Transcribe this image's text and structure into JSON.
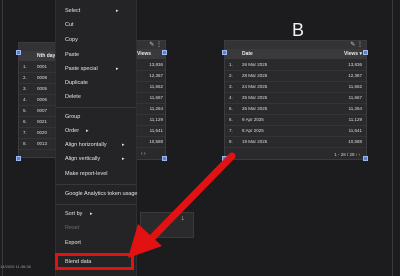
{
  "footer": {
    "timestamp": "14/2025 11:36:36"
  },
  "letter_b": "B",
  "table_left": {
    "header": "Nth day",
    "rows": [
      {
        "num": "1.",
        "val": "0001"
      },
      {
        "num": "2.",
        "val": "0008"
      },
      {
        "num": "3.",
        "val": "0005"
      },
      {
        "num": "4.",
        "val": "0006"
      },
      {
        "num": "5.",
        "val": "0007"
      },
      {
        "num": "6.",
        "val": "0021"
      },
      {
        "num": "7.",
        "val": "0020"
      },
      {
        "num": "8.",
        "val": "0013"
      }
    ]
  },
  "table_mid": {
    "header": "Views",
    "values": [
      "13,836",
      "12,367",
      "11,662",
      "11,667",
      "11,264",
      "11,129",
      "11,641",
      "10,588"
    ]
  },
  "table_right": {
    "col_date": "Date",
    "col_views": "Views",
    "rows": [
      {
        "num": "1.",
        "date": "26 Mar 2025",
        "views": "13,836"
      },
      {
        "num": "2.",
        "date": "28 Mar 2025",
        "views": "12,367"
      },
      {
        "num": "3.",
        "date": "24 Mar 2025",
        "views": "11,662"
      },
      {
        "num": "4.",
        "date": "25 Mar 2025",
        "views": "11,667"
      },
      {
        "num": "5.",
        "date": "26 Mar 2025",
        "views": "11,264"
      },
      {
        "num": "6.",
        "date": "9 Apr 2025",
        "views": "11,129"
      },
      {
        "num": "7.",
        "date": "8 Apr 2025",
        "views": "11,641"
      },
      {
        "num": "8.",
        "date": "19 Mar 2025",
        "views": "10,588"
      }
    ],
    "pager": "1 - 28 / 28"
  },
  "menu": {
    "items": {
      "select": "Select",
      "cut": "Cut",
      "copy": "Copy",
      "paste": "Paste",
      "paste_special": "Paste special",
      "duplicate": "Duplicate",
      "delete": "Delete",
      "group": "Group",
      "order": "Order",
      "align_h": "Align horizontally",
      "align_v": "Align vertically",
      "make_report_level": "Make report-level",
      "ga_token": "Google Analytics token usage",
      "sort_by": "Sort by",
      "reset": "Reset",
      "export": "Export",
      "blend_data": "Blend data"
    }
  },
  "annotation": {
    "highlight_color": "#e31212",
    "arrow_color": "#e31212"
  },
  "accent": "#5a7fd6"
}
